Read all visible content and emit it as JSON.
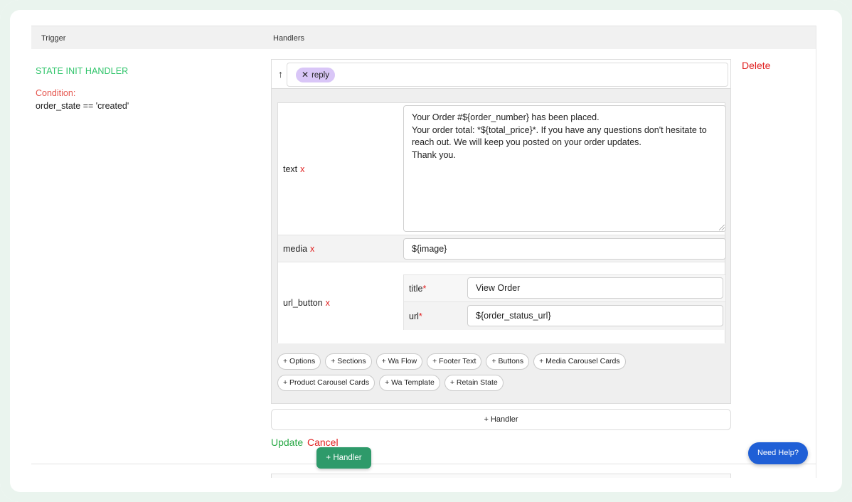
{
  "header": {
    "trigger_label": "Trigger",
    "handlers_label": "Handlers"
  },
  "trigger": {
    "title": "STATE INIT HANDLER",
    "condition_label": "Condition:",
    "condition_value": "order_state == 'created'"
  },
  "handler": {
    "move_up_icon": "arrow-up-icon",
    "chip": {
      "remove_glyph": "✕",
      "label": "reply"
    },
    "fields": {
      "text": {
        "label": "text",
        "remove": "x",
        "value": "Your Order #${order_number} has been placed.\nYour order total: *${total_price}*. If you have any questions don't hesitate to reach out. We will keep you posted on your order updates.\nThank you."
      },
      "media": {
        "label": "media",
        "remove": "x",
        "value": "${image}"
      },
      "url_button": {
        "label": "url_button",
        "remove": "x",
        "title_label": "title",
        "title_value": "View Order",
        "url_label": "url",
        "url_value": "${order_status_url}",
        "required_mark": "*"
      }
    },
    "add_options": [
      "+ Options",
      "+ Sections",
      "+ Wa Flow",
      "+ Footer Text",
      "+ Buttons",
      "+ Media Carousel Cards",
      "+ Product Carousel Cards",
      "+ Wa Template",
      "+ Retain State"
    ]
  },
  "actions": {
    "delete": "Delete",
    "add_handler": "+ Handler",
    "update": "Update",
    "cancel": "Cancel",
    "add_handler_floating": "+ Handler",
    "need_help": "Need Help?"
  },
  "colors": {
    "trigger_title": "#2fc46a",
    "condition_label": "#e5534b",
    "delete": "#e02020",
    "update": "#27a844",
    "chip_bg": "#d9c6f7",
    "floating_button": "#2e9a6a",
    "need_help": "#1f5fd6"
  }
}
